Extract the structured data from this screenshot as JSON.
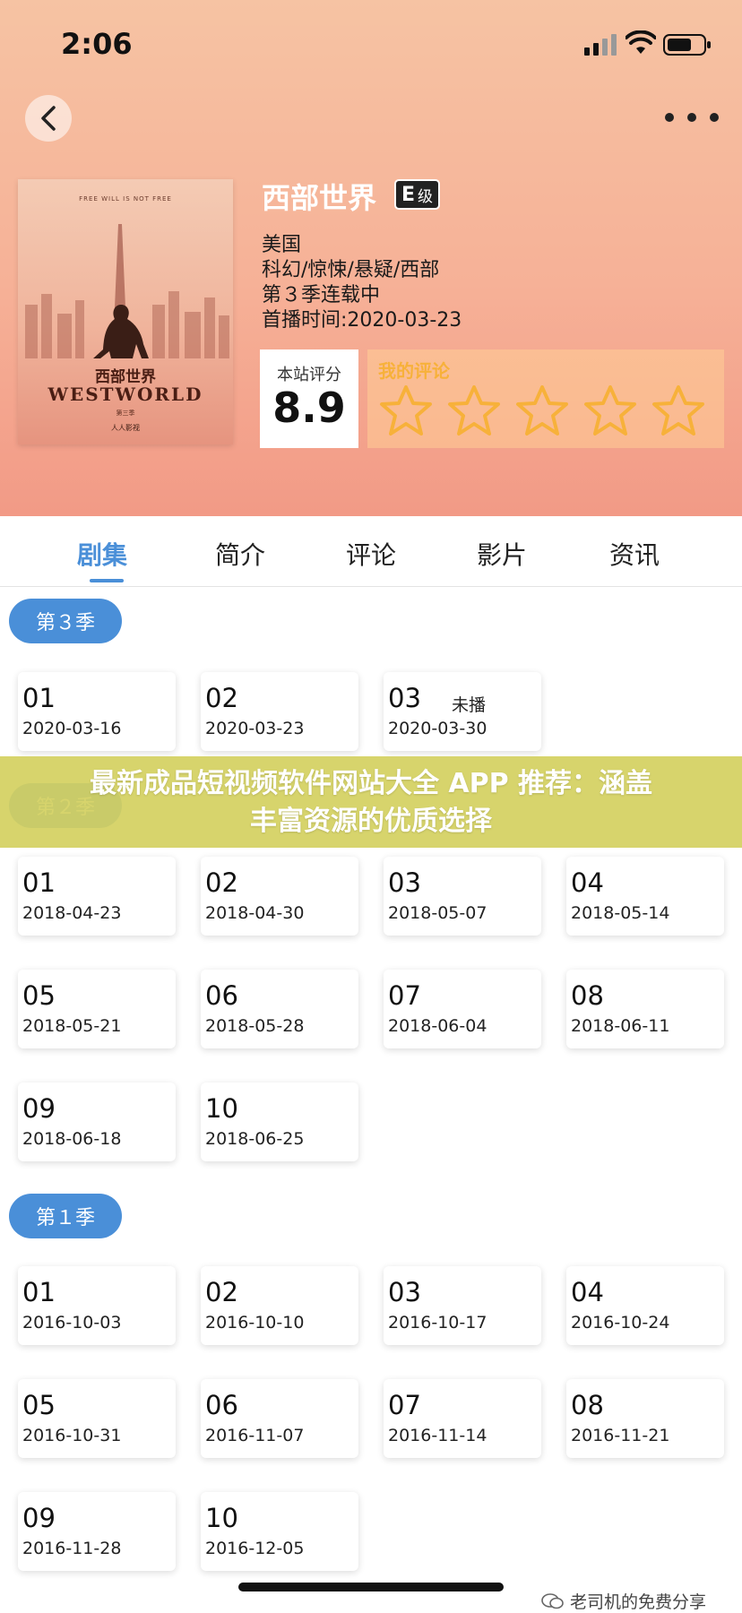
{
  "status_bar": {
    "time": "2:06"
  },
  "header": {
    "title": "西部世界",
    "rating_badge": {
      "letter": "E",
      "suffix": "级"
    },
    "meta": [
      "美国",
      "科幻/惊悚/悬疑/西部",
      "第３季连载中",
      "首播时间:2020-03-23"
    ],
    "score": {
      "label": "本站评分",
      "value": "8.9"
    },
    "my_rating": {
      "label": "我的评论",
      "stars": 5,
      "filled": 0
    },
    "poster": {
      "tagline": "FREE WILL IS NOT FREE",
      "title_cn": "西部世界",
      "title_en": "WESTWORLD",
      "season": "第三季",
      "brand": "人人影视"
    }
  },
  "tabs": [
    {
      "label": "剧集",
      "active": true
    },
    {
      "label": "简介",
      "active": false
    },
    {
      "label": "评论",
      "active": false
    },
    {
      "label": "影片",
      "active": false
    },
    {
      "label": "资讯",
      "active": false
    }
  ],
  "seasons": [
    {
      "label": "第３季",
      "episodes": [
        {
          "num": "01",
          "date": "2020-03-16"
        },
        {
          "num": "02",
          "date": "2020-03-23"
        },
        {
          "num": "03",
          "date": "2020-03-30",
          "tag": "未播"
        }
      ]
    },
    {
      "label": "第２季",
      "episodes": [
        {
          "num": "01",
          "date": "2018-04-23"
        },
        {
          "num": "02",
          "date": "2018-04-30"
        },
        {
          "num": "03",
          "date": "2018-05-07"
        },
        {
          "num": "04",
          "date": "2018-05-14"
        },
        {
          "num": "05",
          "date": "2018-05-21"
        },
        {
          "num": "06",
          "date": "2018-05-28"
        },
        {
          "num": "07",
          "date": "2018-06-04"
        },
        {
          "num": "08",
          "date": "2018-06-11"
        },
        {
          "num": "09",
          "date": "2018-06-18"
        },
        {
          "num": "10",
          "date": "2018-06-25"
        }
      ]
    },
    {
      "label": "第１季",
      "episodes": [
        {
          "num": "01",
          "date": "2016-10-03"
        },
        {
          "num": "02",
          "date": "2016-10-10"
        },
        {
          "num": "03",
          "date": "2016-10-17"
        },
        {
          "num": "04",
          "date": "2016-10-24"
        },
        {
          "num": "05",
          "date": "2016-10-31"
        },
        {
          "num": "06",
          "date": "2016-11-07"
        },
        {
          "num": "07",
          "date": "2016-11-14"
        },
        {
          "num": "08",
          "date": "2016-11-21"
        },
        {
          "num": "09",
          "date": "2016-11-28"
        },
        {
          "num": "10",
          "date": "2016-12-05"
        }
      ]
    }
  ],
  "banner": {
    "line1": "最新成品短视频软件网站大全 APP 推荐：涵盖",
    "line2": "丰富资源的优质选择"
  },
  "watermark": "老司机的免费分享",
  "colors": {
    "accent": "#4a8fd8",
    "header_gradient_top": "#f6c3a3",
    "header_gradient_bottom": "#f29a86",
    "banner": "#d4d060",
    "star": "#f7b13a"
  }
}
